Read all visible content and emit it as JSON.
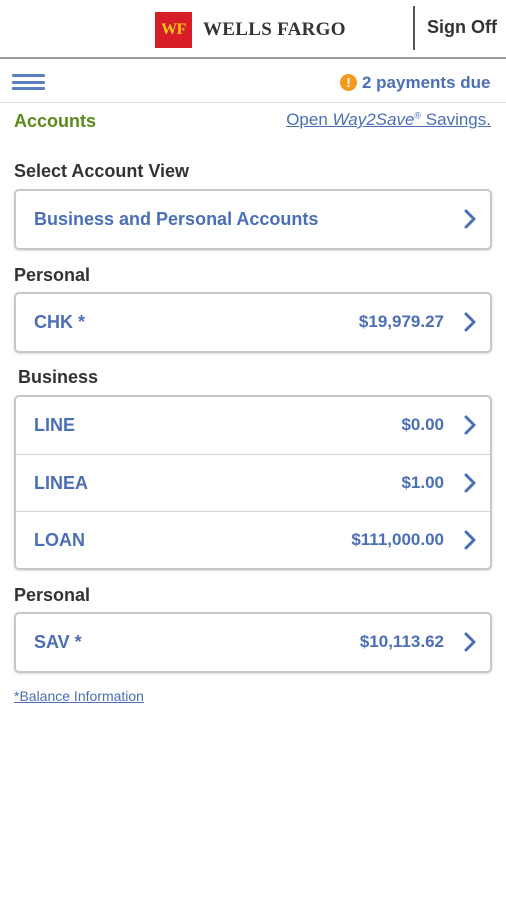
{
  "header": {
    "logo_mark": "WF",
    "brand": "WELLS FARGO",
    "signoff_label": "Sign Off"
  },
  "subbar": {
    "menu_icon": "hamburger-menu-icon",
    "alert_icon": "exclamation-circle-icon",
    "alert_glyph": "!",
    "payments_due": "2 payments due"
  },
  "accounts_tab": "Accounts",
  "promo": {
    "prefix": "Open ",
    "product": "Way2Save",
    "reg": "®",
    "suffix": " Savings."
  },
  "select_view": {
    "label": "Select Account View",
    "value": "Business and Personal Accounts"
  },
  "groups": [
    {
      "label": "Personal",
      "accounts": [
        {
          "name": "CHK *",
          "balance": "$19,979.27"
        }
      ]
    },
    {
      "label": "Business",
      "accounts": [
        {
          "name": "LINE",
          "balance": "$0.00"
        },
        {
          "name": "LINEA",
          "balance": "$1.00"
        },
        {
          "name": "LOAN",
          "balance": "$111,000.00"
        }
      ]
    },
    {
      "label": "Personal",
      "accounts": [
        {
          "name": "SAV *",
          "balance": "$10,113.62"
        }
      ]
    }
  ],
  "balance_info_link": "*Balance Information",
  "colors": {
    "brand_red": "#d71e28",
    "brand_gold": "#f5c518",
    "link_blue": "#4a6fb5",
    "accounts_green": "#5a8a1a",
    "alert_orange": "#f29a1f"
  }
}
